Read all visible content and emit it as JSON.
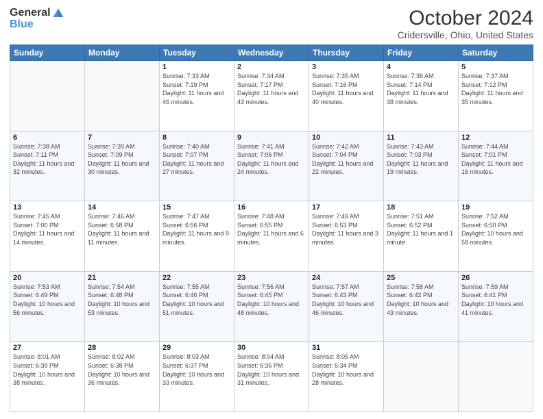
{
  "header": {
    "logo_general": "General",
    "logo_blue": "Blue",
    "title": "October 2024",
    "subtitle": "Cridersville, Ohio, United States"
  },
  "weekdays": [
    "Sunday",
    "Monday",
    "Tuesday",
    "Wednesday",
    "Thursday",
    "Friday",
    "Saturday"
  ],
  "weeks": [
    [
      {
        "day": "",
        "sunrise": "",
        "sunset": "",
        "daylight": ""
      },
      {
        "day": "",
        "sunrise": "",
        "sunset": "",
        "daylight": ""
      },
      {
        "day": "1",
        "sunrise": "Sunrise: 7:33 AM",
        "sunset": "Sunset: 7:19 PM",
        "daylight": "Daylight: 11 hours and 46 minutes."
      },
      {
        "day": "2",
        "sunrise": "Sunrise: 7:34 AM",
        "sunset": "Sunset: 7:17 PM",
        "daylight": "Daylight: 11 hours and 43 minutes."
      },
      {
        "day": "3",
        "sunrise": "Sunrise: 7:35 AM",
        "sunset": "Sunset: 7:16 PM",
        "daylight": "Daylight: 11 hours and 40 minutes."
      },
      {
        "day": "4",
        "sunrise": "Sunrise: 7:36 AM",
        "sunset": "Sunset: 7:14 PM",
        "daylight": "Daylight: 11 hours and 38 minutes."
      },
      {
        "day": "5",
        "sunrise": "Sunrise: 7:37 AM",
        "sunset": "Sunset: 7:12 PM",
        "daylight": "Daylight: 11 hours and 35 minutes."
      }
    ],
    [
      {
        "day": "6",
        "sunrise": "Sunrise: 7:38 AM",
        "sunset": "Sunset: 7:11 PM",
        "daylight": "Daylight: 11 hours and 32 minutes."
      },
      {
        "day": "7",
        "sunrise": "Sunrise: 7:39 AM",
        "sunset": "Sunset: 7:09 PM",
        "daylight": "Daylight: 11 hours and 30 minutes."
      },
      {
        "day": "8",
        "sunrise": "Sunrise: 7:40 AM",
        "sunset": "Sunset: 7:07 PM",
        "daylight": "Daylight: 11 hours and 27 minutes."
      },
      {
        "day": "9",
        "sunrise": "Sunrise: 7:41 AM",
        "sunset": "Sunset: 7:06 PM",
        "daylight": "Daylight: 11 hours and 24 minutes."
      },
      {
        "day": "10",
        "sunrise": "Sunrise: 7:42 AM",
        "sunset": "Sunset: 7:04 PM",
        "daylight": "Daylight: 11 hours and 22 minutes."
      },
      {
        "day": "11",
        "sunrise": "Sunrise: 7:43 AM",
        "sunset": "Sunset: 7:03 PM",
        "daylight": "Daylight: 11 hours and 19 minutes."
      },
      {
        "day": "12",
        "sunrise": "Sunrise: 7:44 AM",
        "sunset": "Sunset: 7:01 PM",
        "daylight": "Daylight: 11 hours and 16 minutes."
      }
    ],
    [
      {
        "day": "13",
        "sunrise": "Sunrise: 7:45 AM",
        "sunset": "Sunset: 7:00 PM",
        "daylight": "Daylight: 11 hours and 14 minutes."
      },
      {
        "day": "14",
        "sunrise": "Sunrise: 7:46 AM",
        "sunset": "Sunset: 6:58 PM",
        "daylight": "Daylight: 11 hours and 11 minutes."
      },
      {
        "day": "15",
        "sunrise": "Sunrise: 7:47 AM",
        "sunset": "Sunset: 6:56 PM",
        "daylight": "Daylight: 11 hours and 9 minutes."
      },
      {
        "day": "16",
        "sunrise": "Sunrise: 7:48 AM",
        "sunset": "Sunset: 6:55 PM",
        "daylight": "Daylight: 11 hours and 6 minutes."
      },
      {
        "day": "17",
        "sunrise": "Sunrise: 7:49 AM",
        "sunset": "Sunset: 6:53 PM",
        "daylight": "Daylight: 11 hours and 3 minutes."
      },
      {
        "day": "18",
        "sunrise": "Sunrise: 7:51 AM",
        "sunset": "Sunset: 6:52 PM",
        "daylight": "Daylight: 11 hours and 1 minute."
      },
      {
        "day": "19",
        "sunrise": "Sunrise: 7:52 AM",
        "sunset": "Sunset: 6:50 PM",
        "daylight": "Daylight: 10 hours and 58 minutes."
      }
    ],
    [
      {
        "day": "20",
        "sunrise": "Sunrise: 7:53 AM",
        "sunset": "Sunset: 6:49 PM",
        "daylight": "Daylight: 10 hours and 56 minutes."
      },
      {
        "day": "21",
        "sunrise": "Sunrise: 7:54 AM",
        "sunset": "Sunset: 6:48 PM",
        "daylight": "Daylight: 10 hours and 53 minutes."
      },
      {
        "day": "22",
        "sunrise": "Sunrise: 7:55 AM",
        "sunset": "Sunset: 6:46 PM",
        "daylight": "Daylight: 10 hours and 51 minutes."
      },
      {
        "day": "23",
        "sunrise": "Sunrise: 7:56 AM",
        "sunset": "Sunset: 6:45 PM",
        "daylight": "Daylight: 10 hours and 48 minutes."
      },
      {
        "day": "24",
        "sunrise": "Sunrise: 7:57 AM",
        "sunset": "Sunset: 6:43 PM",
        "daylight": "Daylight: 10 hours and 46 minutes."
      },
      {
        "day": "25",
        "sunrise": "Sunrise: 7:58 AM",
        "sunset": "Sunset: 6:42 PM",
        "daylight": "Daylight: 10 hours and 43 minutes."
      },
      {
        "day": "26",
        "sunrise": "Sunrise: 7:59 AM",
        "sunset": "Sunset: 6:41 PM",
        "daylight": "Daylight: 10 hours and 41 minutes."
      }
    ],
    [
      {
        "day": "27",
        "sunrise": "Sunrise: 8:01 AM",
        "sunset": "Sunset: 6:39 PM",
        "daylight": "Daylight: 10 hours and 38 minutes."
      },
      {
        "day": "28",
        "sunrise": "Sunrise: 8:02 AM",
        "sunset": "Sunset: 6:38 PM",
        "daylight": "Daylight: 10 hours and 36 minutes."
      },
      {
        "day": "29",
        "sunrise": "Sunrise: 8:03 AM",
        "sunset": "Sunset: 6:37 PM",
        "daylight": "Daylight: 10 hours and 33 minutes."
      },
      {
        "day": "30",
        "sunrise": "Sunrise: 8:04 AM",
        "sunset": "Sunset: 6:35 PM",
        "daylight": "Daylight: 10 hours and 31 minutes."
      },
      {
        "day": "31",
        "sunrise": "Sunrise: 8:05 AM",
        "sunset": "Sunset: 6:34 PM",
        "daylight": "Daylight: 10 hours and 28 minutes."
      },
      {
        "day": "",
        "sunrise": "",
        "sunset": "",
        "daylight": ""
      },
      {
        "day": "",
        "sunrise": "",
        "sunset": "",
        "daylight": ""
      }
    ]
  ]
}
